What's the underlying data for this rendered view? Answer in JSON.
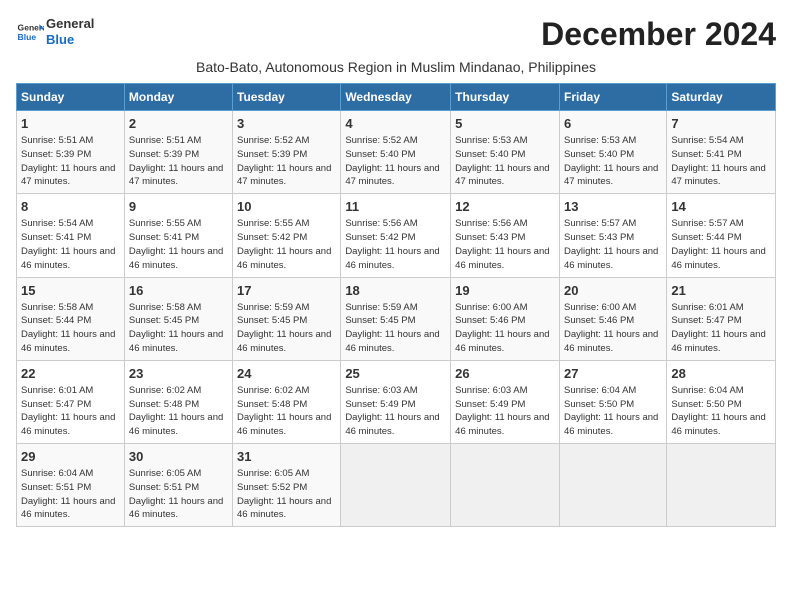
{
  "logo": {
    "general": "General",
    "blue": "Blue"
  },
  "title": "December 2024",
  "subtitle": "Bato-Bato, Autonomous Region in Muslim Mindanao, Philippines",
  "days_of_week": [
    "Sunday",
    "Monday",
    "Tuesday",
    "Wednesday",
    "Thursday",
    "Friday",
    "Saturday"
  ],
  "weeks": [
    [
      {
        "day": "1",
        "sunrise": "Sunrise: 5:51 AM",
        "sunset": "Sunset: 5:39 PM",
        "daylight": "Daylight: 11 hours and 47 minutes."
      },
      {
        "day": "2",
        "sunrise": "Sunrise: 5:51 AM",
        "sunset": "Sunset: 5:39 PM",
        "daylight": "Daylight: 11 hours and 47 minutes."
      },
      {
        "day": "3",
        "sunrise": "Sunrise: 5:52 AM",
        "sunset": "Sunset: 5:39 PM",
        "daylight": "Daylight: 11 hours and 47 minutes."
      },
      {
        "day": "4",
        "sunrise": "Sunrise: 5:52 AM",
        "sunset": "Sunset: 5:40 PM",
        "daylight": "Daylight: 11 hours and 47 minutes."
      },
      {
        "day": "5",
        "sunrise": "Sunrise: 5:53 AM",
        "sunset": "Sunset: 5:40 PM",
        "daylight": "Daylight: 11 hours and 47 minutes."
      },
      {
        "day": "6",
        "sunrise": "Sunrise: 5:53 AM",
        "sunset": "Sunset: 5:40 PM",
        "daylight": "Daylight: 11 hours and 47 minutes."
      },
      {
        "day": "7",
        "sunrise": "Sunrise: 5:54 AM",
        "sunset": "Sunset: 5:41 PM",
        "daylight": "Daylight: 11 hours and 47 minutes."
      }
    ],
    [
      {
        "day": "8",
        "sunrise": "Sunrise: 5:54 AM",
        "sunset": "Sunset: 5:41 PM",
        "daylight": "Daylight: 11 hours and 46 minutes."
      },
      {
        "day": "9",
        "sunrise": "Sunrise: 5:55 AM",
        "sunset": "Sunset: 5:41 PM",
        "daylight": "Daylight: 11 hours and 46 minutes."
      },
      {
        "day": "10",
        "sunrise": "Sunrise: 5:55 AM",
        "sunset": "Sunset: 5:42 PM",
        "daylight": "Daylight: 11 hours and 46 minutes."
      },
      {
        "day": "11",
        "sunrise": "Sunrise: 5:56 AM",
        "sunset": "Sunset: 5:42 PM",
        "daylight": "Daylight: 11 hours and 46 minutes."
      },
      {
        "day": "12",
        "sunrise": "Sunrise: 5:56 AM",
        "sunset": "Sunset: 5:43 PM",
        "daylight": "Daylight: 11 hours and 46 minutes."
      },
      {
        "day": "13",
        "sunrise": "Sunrise: 5:57 AM",
        "sunset": "Sunset: 5:43 PM",
        "daylight": "Daylight: 11 hours and 46 minutes."
      },
      {
        "day": "14",
        "sunrise": "Sunrise: 5:57 AM",
        "sunset": "Sunset: 5:44 PM",
        "daylight": "Daylight: 11 hours and 46 minutes."
      }
    ],
    [
      {
        "day": "15",
        "sunrise": "Sunrise: 5:58 AM",
        "sunset": "Sunset: 5:44 PM",
        "daylight": "Daylight: 11 hours and 46 minutes."
      },
      {
        "day": "16",
        "sunrise": "Sunrise: 5:58 AM",
        "sunset": "Sunset: 5:45 PM",
        "daylight": "Daylight: 11 hours and 46 minutes."
      },
      {
        "day": "17",
        "sunrise": "Sunrise: 5:59 AM",
        "sunset": "Sunset: 5:45 PM",
        "daylight": "Daylight: 11 hours and 46 minutes."
      },
      {
        "day": "18",
        "sunrise": "Sunrise: 5:59 AM",
        "sunset": "Sunset: 5:45 PM",
        "daylight": "Daylight: 11 hours and 46 minutes."
      },
      {
        "day": "19",
        "sunrise": "Sunrise: 6:00 AM",
        "sunset": "Sunset: 5:46 PM",
        "daylight": "Daylight: 11 hours and 46 minutes."
      },
      {
        "day": "20",
        "sunrise": "Sunrise: 6:00 AM",
        "sunset": "Sunset: 5:46 PM",
        "daylight": "Daylight: 11 hours and 46 minutes."
      },
      {
        "day": "21",
        "sunrise": "Sunrise: 6:01 AM",
        "sunset": "Sunset: 5:47 PM",
        "daylight": "Daylight: 11 hours and 46 minutes."
      }
    ],
    [
      {
        "day": "22",
        "sunrise": "Sunrise: 6:01 AM",
        "sunset": "Sunset: 5:47 PM",
        "daylight": "Daylight: 11 hours and 46 minutes."
      },
      {
        "day": "23",
        "sunrise": "Sunrise: 6:02 AM",
        "sunset": "Sunset: 5:48 PM",
        "daylight": "Daylight: 11 hours and 46 minutes."
      },
      {
        "day": "24",
        "sunrise": "Sunrise: 6:02 AM",
        "sunset": "Sunset: 5:48 PM",
        "daylight": "Daylight: 11 hours and 46 minutes."
      },
      {
        "day": "25",
        "sunrise": "Sunrise: 6:03 AM",
        "sunset": "Sunset: 5:49 PM",
        "daylight": "Daylight: 11 hours and 46 minutes."
      },
      {
        "day": "26",
        "sunrise": "Sunrise: 6:03 AM",
        "sunset": "Sunset: 5:49 PM",
        "daylight": "Daylight: 11 hours and 46 minutes."
      },
      {
        "day": "27",
        "sunrise": "Sunrise: 6:04 AM",
        "sunset": "Sunset: 5:50 PM",
        "daylight": "Daylight: 11 hours and 46 minutes."
      },
      {
        "day": "28",
        "sunrise": "Sunrise: 6:04 AM",
        "sunset": "Sunset: 5:50 PM",
        "daylight": "Daylight: 11 hours and 46 minutes."
      }
    ],
    [
      {
        "day": "29",
        "sunrise": "Sunrise: 6:04 AM",
        "sunset": "Sunset: 5:51 PM",
        "daylight": "Daylight: 11 hours and 46 minutes."
      },
      {
        "day": "30",
        "sunrise": "Sunrise: 6:05 AM",
        "sunset": "Sunset: 5:51 PM",
        "daylight": "Daylight: 11 hours and 46 minutes."
      },
      {
        "day": "31",
        "sunrise": "Sunrise: 6:05 AM",
        "sunset": "Sunset: 5:52 PM",
        "daylight": "Daylight: 11 hours and 46 minutes."
      },
      null,
      null,
      null,
      null
    ]
  ]
}
